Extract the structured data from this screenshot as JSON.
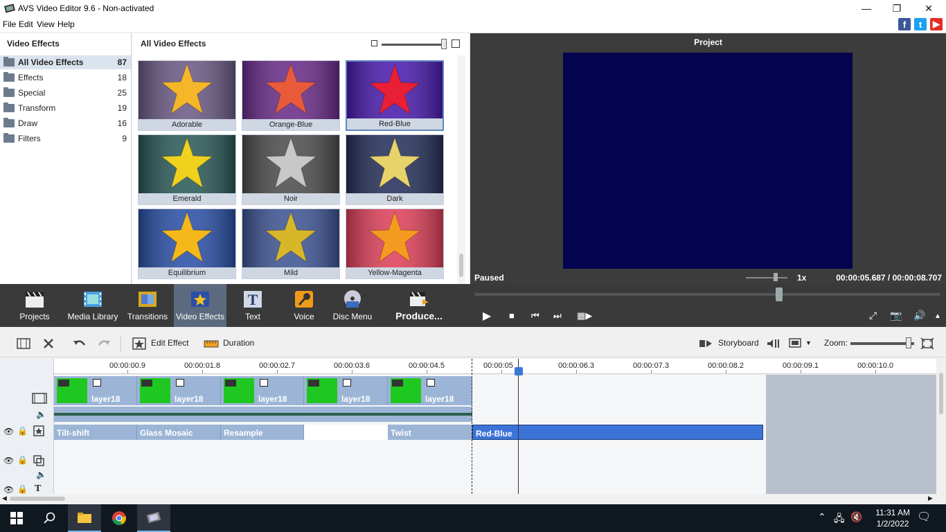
{
  "window": {
    "title": "AVS Video Editor 9.6 - Non-activated"
  },
  "menu": [
    "File",
    "Edit",
    "View",
    "Help"
  ],
  "left_panel": {
    "header": "Video Effects",
    "categories": [
      {
        "label": "All Video Effects",
        "count": "87"
      },
      {
        "label": "Effects",
        "count": "18"
      },
      {
        "label": "Special",
        "count": "25"
      },
      {
        "label": "Transform",
        "count": "19"
      },
      {
        "label": "Draw",
        "count": "16"
      },
      {
        "label": "Filters",
        "count": "9"
      }
    ]
  },
  "grid": {
    "header": "All Video Effects",
    "tiles": [
      {
        "label": "Adorable",
        "bg": "#6b5a86",
        "star": "#f5b62a"
      },
      {
        "label": "Orange-Blue",
        "bg": "#6a2c8a",
        "star": "#e85a3a"
      },
      {
        "label": "Red-Blue",
        "bg": "#4a1bb0",
        "star": "#e81f35"
      },
      {
        "label": "Emerald",
        "bg": "#2a5a58",
        "star": "#f0d21e"
      },
      {
        "label": "Noir",
        "bg": "#4d4d4d",
        "star": "#c8c8c8"
      },
      {
        "label": "Dark",
        "bg": "#25305a",
        "star": "#e8d26a"
      },
      {
        "label": "Equilibrium",
        "bg": "#2a50a8",
        "star": "#f5b81a"
      },
      {
        "label": "Mild",
        "bg": "#3e5596",
        "star": "#d8b62a"
      },
      {
        "label": "Yellow-Magenta",
        "bg": "#e0405a",
        "star": "#f59a20"
      }
    ]
  },
  "preview": {
    "title": "Project",
    "status": "Paused",
    "speed": "1x",
    "timecode": "00:00:05.687  /  00:00:08.707"
  },
  "toolbar": [
    {
      "label": "Projects",
      "icon": "clapper-icon"
    },
    {
      "label": "Media Library",
      "icon": "film-icon"
    },
    {
      "label": "Transitions",
      "icon": "transitions-icon"
    },
    {
      "label": "Video Effects",
      "icon": "star-icon"
    },
    {
      "label": "Text",
      "icon": "text-icon"
    },
    {
      "label": "Voice",
      "icon": "microphone-icon"
    },
    {
      "label": "Disc Menu",
      "icon": "disc-icon"
    },
    {
      "label": "Produce...",
      "icon": "produce-icon"
    }
  ],
  "timeline_toolbar": {
    "edit_effect": "Edit Effect",
    "duration": "Duration",
    "storyboard": "Storyboard",
    "zoom": "Zoom:"
  },
  "ruler": [
    "00:00:00.9",
    "00:00:01.8",
    "00:00:02.7",
    "00:00:03.6",
    "00:00:04.5",
    "00:00:05",
    "00:00:06.3",
    "00:00:07.3",
    "00:00:08.2",
    "00:00:09.1",
    "00:00:10.0"
  ],
  "video_clips": [
    "layer18",
    "layer18",
    "layer18",
    "layer18",
    "layer18"
  ],
  "effect_clips": [
    "Tilt-shift",
    "Glass Mosaic",
    "Resample",
    "Twist",
    "Red-Blue"
  ],
  "taskbar": {
    "time": "11:31 AM",
    "date": "1/2/2022"
  },
  "colors": {
    "accent": "#3b73d8",
    "preview_bg": "#03034e",
    "clip": "#9cb5d6"
  }
}
